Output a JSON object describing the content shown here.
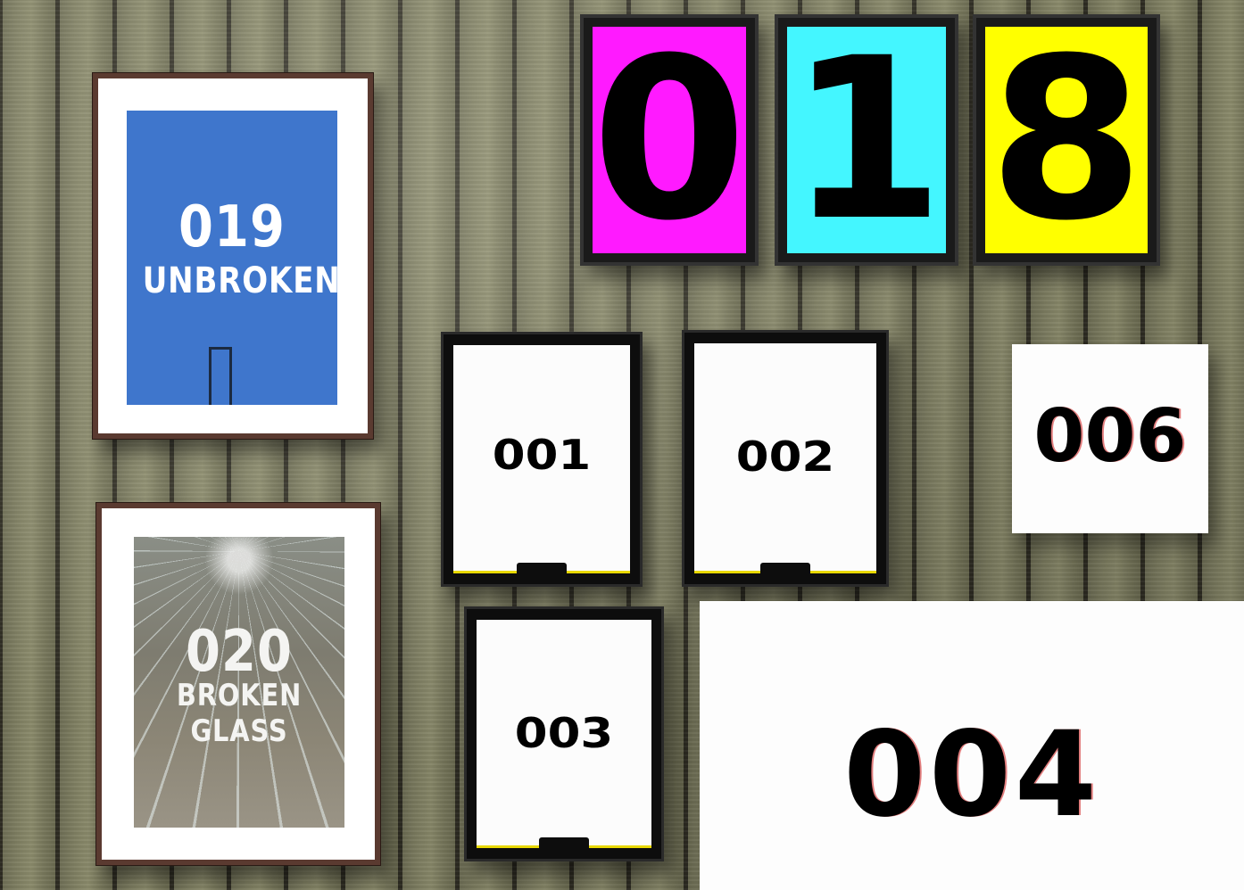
{
  "posters": {
    "unbroken": {
      "number": "019",
      "title": "UNBROKEN"
    },
    "broken_glass": {
      "number": "020",
      "title": "BROKEN GLASS"
    }
  },
  "big_digits": [
    {
      "digit": "0",
      "color": "#ff1aff"
    },
    {
      "digit": "1",
      "color": "#44f6ff"
    },
    {
      "digit": "8",
      "color": "#ffff00"
    }
  ],
  "framed_cards": {
    "card_001": "001",
    "card_002": "002",
    "card_003": "003"
  },
  "plain_cards": {
    "card_006": "006",
    "card_004": "004"
  },
  "colors": {
    "blue_poster": "#3f76cc",
    "magenta": "#ff1aff",
    "cyan": "#44f6ff",
    "yellow": "#ffff00"
  }
}
